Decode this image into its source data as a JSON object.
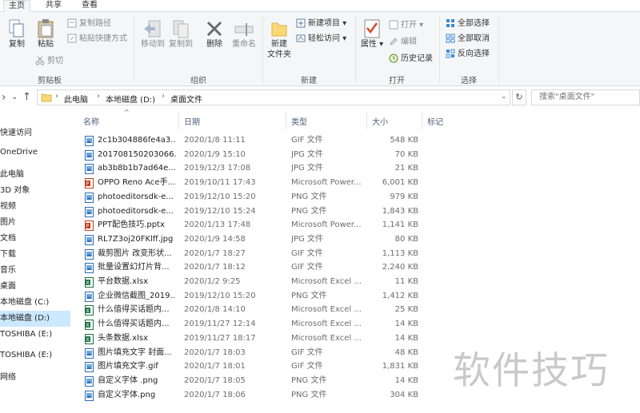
{
  "ribbon_tabs": [
    "主页",
    "共享",
    "查看"
  ],
  "ribbon": {
    "clipboard": {
      "copy": "复制",
      "paste": "粘贴",
      "copy_path": "复制路径",
      "paste_shortcut": "粘贴快捷方式",
      "cut": "剪切",
      "label": "剪贴板"
    },
    "organize": {
      "move_to": "移动到",
      "copy_to": "复制到",
      "delete": "删除",
      "rename": "重命名",
      "label": "组织"
    },
    "new": {
      "new_folder": "新建",
      "new_folder_line2": "文件夹",
      "new_item": "新建项目",
      "easy_access": "轻松访问",
      "label": "新建"
    },
    "open": {
      "properties": "属性",
      "open": "打开",
      "edit": "编辑",
      "history": "历史记录",
      "label": "打开"
    },
    "select": {
      "select_all": "全部选择",
      "select_none": "全部取消",
      "invert": "反向选择",
      "label": "选择"
    }
  },
  "address": {
    "crumbs": [
      "此电脑",
      "本地磁盘 (D:)",
      "桌面文件"
    ],
    "search_placeholder": "搜索\"桌面文件\""
  },
  "sidebar": {
    "items": [
      "快速访问",
      "OneDrive",
      "此电脑",
      "3D 对象",
      "视频",
      "图片",
      "文档",
      "下载",
      "音乐",
      "桌面",
      "本地磁盘 (C:)",
      "本地磁盘 (D:)",
      "TOSHIBA (E:)",
      "TOSHIBA (E:)",
      "网络"
    ],
    "selected_index": 11
  },
  "columns": {
    "name": "名称",
    "date": "日期",
    "type": "类型",
    "size": "大小",
    "tags": "标记"
  },
  "files": [
    {
      "name": "2c1b304886fe4a3...",
      "date": "2020/1/8 11:11",
      "type": "GIF 文件",
      "size": "548 KB",
      "icon": "image"
    },
    {
      "name": "201708150203066...",
      "date": "2020/1/9 15:10",
      "type": "JPG 文件",
      "size": "70 KB",
      "icon": "image"
    },
    {
      "name": "ab3b8b1b7ad64e...",
      "date": "2019/12/3 17:08",
      "type": "JPG 文件",
      "size": "21 KB",
      "icon": "image"
    },
    {
      "name": "OPPO Reno Ace手...",
      "date": "2019/10/11 17:43",
      "type": "Microsoft Power...",
      "size": "6,001 KB",
      "icon": "ppt"
    },
    {
      "name": "photoeditorsdk-e...",
      "date": "2019/12/10 15:20",
      "type": "PNG 文件",
      "size": "979 KB",
      "icon": "image"
    },
    {
      "name": "photoeditorsdk-e...",
      "date": "2019/12/10 15:24",
      "type": "PNG 文件",
      "size": "1,843 KB",
      "icon": "image"
    },
    {
      "name": "PPT配色技巧.pptx",
      "date": "2020/1/13 17:48",
      "type": "Microsoft Power...",
      "size": "1,141 KB",
      "icon": "ppt"
    },
    {
      "name": "RL7Z3oj20FKlff.jpg",
      "date": "2020/1/9 14:58",
      "type": "JPG 文件",
      "size": "80 KB",
      "icon": "image"
    },
    {
      "name": "裁剪图片 改变形状...",
      "date": "2020/1/7 18:27",
      "type": "GIF 文件",
      "size": "1,113 KB",
      "icon": "image"
    },
    {
      "name": "批量设置幻灯片背...",
      "date": "2020/1/7 18:12",
      "type": "GIF 文件",
      "size": "2,240 KB",
      "icon": "image"
    },
    {
      "name": "平台数据.xlsx",
      "date": "2020/1/2 9:25",
      "type": "Microsoft Excel ...",
      "size": "11 KB",
      "icon": "excel"
    },
    {
      "name": "企业微信截图_2019...",
      "date": "2019/12/10 15:20",
      "type": "PNG 文件",
      "size": "1,412 KB",
      "icon": "image"
    },
    {
      "name": "什么值得买话题内...",
      "date": "2020/1/8 14:10",
      "type": "Microsoft Excel ...",
      "size": "25 KB",
      "icon": "excel"
    },
    {
      "name": "什么值得买话题内...",
      "date": "2019/11/27 12:14",
      "type": "Microsoft Excel ...",
      "size": "14 KB",
      "icon": "excel"
    },
    {
      "name": "头条数据.xlsx",
      "date": "2019/11/27 18:17",
      "type": "Microsoft Excel ...",
      "size": "14 KB",
      "icon": "excel"
    },
    {
      "name": "图片填充文字 封面...",
      "date": "2020/1/7 18:03",
      "type": "GIF 文件",
      "size": "48 KB",
      "icon": "image"
    },
    {
      "name": "图片填充文字.gif",
      "date": "2020/1/7 18:01",
      "type": "GIF 文件",
      "size": "1,831 KB",
      "icon": "image"
    },
    {
      "name": "自定义字体 .png",
      "date": "2020/1/7 18:05",
      "type": "PNG 文件",
      "size": "14 KB",
      "icon": "image"
    },
    {
      "name": "自定义字体.png",
      "date": "2020/1/7 18:06",
      "type": "PNG 文件",
      "size": "304 KB",
      "icon": "image"
    }
  ],
  "watermark": "软件技巧",
  "colors": {
    "accent": "#0063b1",
    "selection": "#cce8ff",
    "ppt": "#c43e1c",
    "excel": "#1e7145",
    "folder": "#f8d775"
  }
}
